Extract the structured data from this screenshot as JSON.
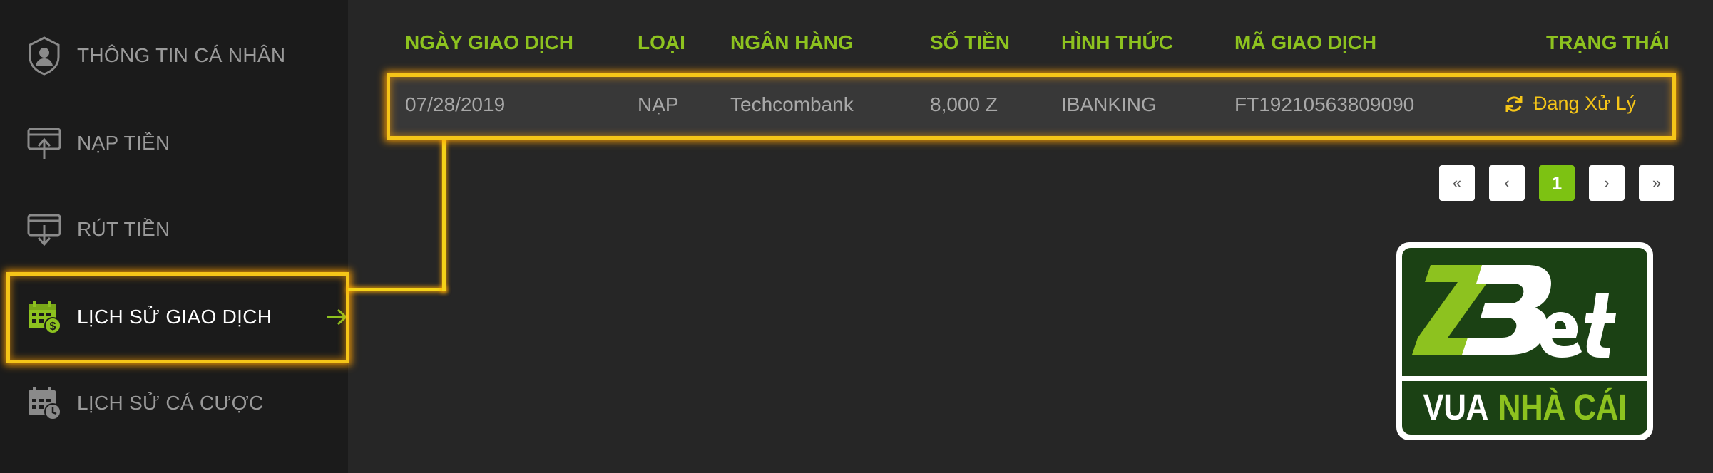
{
  "sidebar": {
    "items": [
      {
        "label": "THÔNG TIN CÁ NHÂN",
        "icon": "user-shield-icon"
      },
      {
        "label": "NẠP TIỀN",
        "icon": "deposit-icon"
      },
      {
        "label": "RÚT TIỀN",
        "icon": "withdraw-icon"
      },
      {
        "label": "LỊCH SỬ GIAO DỊCH",
        "icon": "calendar-dollar-icon",
        "active": true
      },
      {
        "label": "LỊCH SỬ CÁ CƯỢC",
        "icon": "calendar-clock-icon"
      }
    ]
  },
  "table": {
    "headers": [
      "NGÀY GIAO DỊCH",
      "LOẠI",
      "NGÂN HÀNG",
      "SỐ TIỀN",
      "HÌNH THỨC",
      "MÃ GIAO DỊCH",
      "TRẠNG THÁI"
    ],
    "rows": [
      {
        "date": "07/28/2019",
        "type": "NẠP",
        "bank": "Techcombank",
        "amount": "8,000 Z",
        "method": "IBANKING",
        "code": "FT19210563809090",
        "status": "Đang Xử Lý"
      }
    ]
  },
  "pagination": {
    "first": "«",
    "prev": "‹",
    "current": "1",
    "next": "›",
    "last": "»"
  },
  "logo": {
    "brand": "ZBet",
    "tagline_1": "VUA",
    "tagline_2": "NHÀ CÁI"
  },
  "colors": {
    "accent_green": "#8dc21f",
    "highlight_yellow": "#f5c518",
    "sidebar_bg": "#1b1b1b",
    "main_bg": "#262626"
  }
}
